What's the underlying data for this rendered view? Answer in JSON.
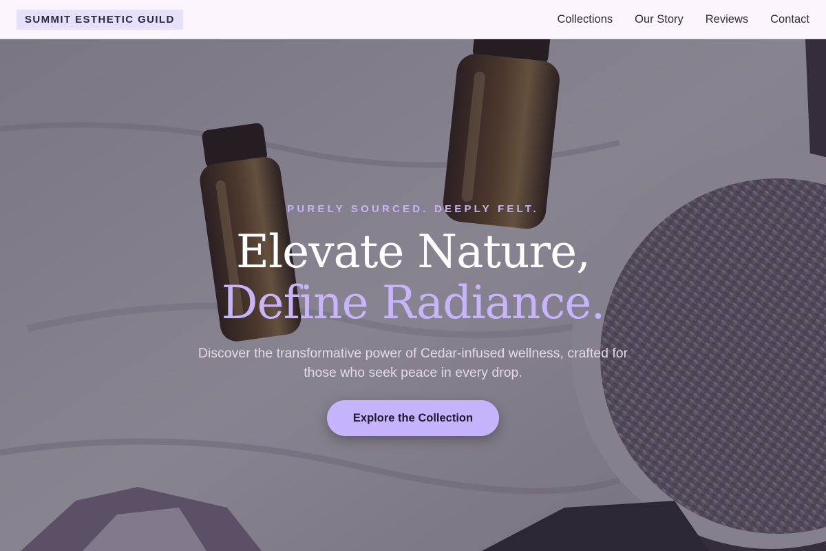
{
  "header": {
    "brand": "SUMMIT ESTHETIC GUILD",
    "nav": [
      "Collections",
      "Our Story",
      "Reviews",
      "Contact"
    ]
  },
  "hero": {
    "eyebrow": "PURELY SOURCED. DEEPLY FELT.",
    "headline_line1": "Elevate Nature,",
    "headline_line2": "Define Radiance.",
    "subtext": "Discover the transformative power of Cedar-infused wellness, crafted for those who seek peace in every drop.",
    "cta_label": "Explore the Collection"
  },
  "colors": {
    "header_bg": "#fbf5fe",
    "brand_bg": "#e6e1fa",
    "accent": "#c5b3fb",
    "eyebrow": "#c8b5f6",
    "headline_white": "#ffffff",
    "headline_accent": "#c7b4fb"
  }
}
